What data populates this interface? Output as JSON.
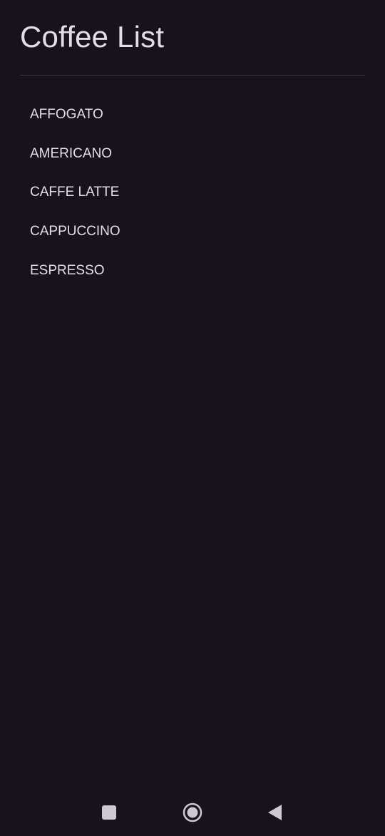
{
  "header": {
    "title": "Coffee List"
  },
  "coffees": [
    {
      "name": "AFFOGATO"
    },
    {
      "name": "AMERICANO"
    },
    {
      "name": "CAFFE LATTE"
    },
    {
      "name": "CAPPUCCINO"
    },
    {
      "name": "ESPRESSO"
    }
  ],
  "nav": {
    "recents_icon": "square-icon",
    "home_icon": "circle-icon",
    "back_icon": "triangle-back-icon"
  },
  "colors": {
    "background": "#16141a",
    "text": "#e4dde9",
    "divider": "#3a3640",
    "nav_icon": "#cfc8d4"
  }
}
